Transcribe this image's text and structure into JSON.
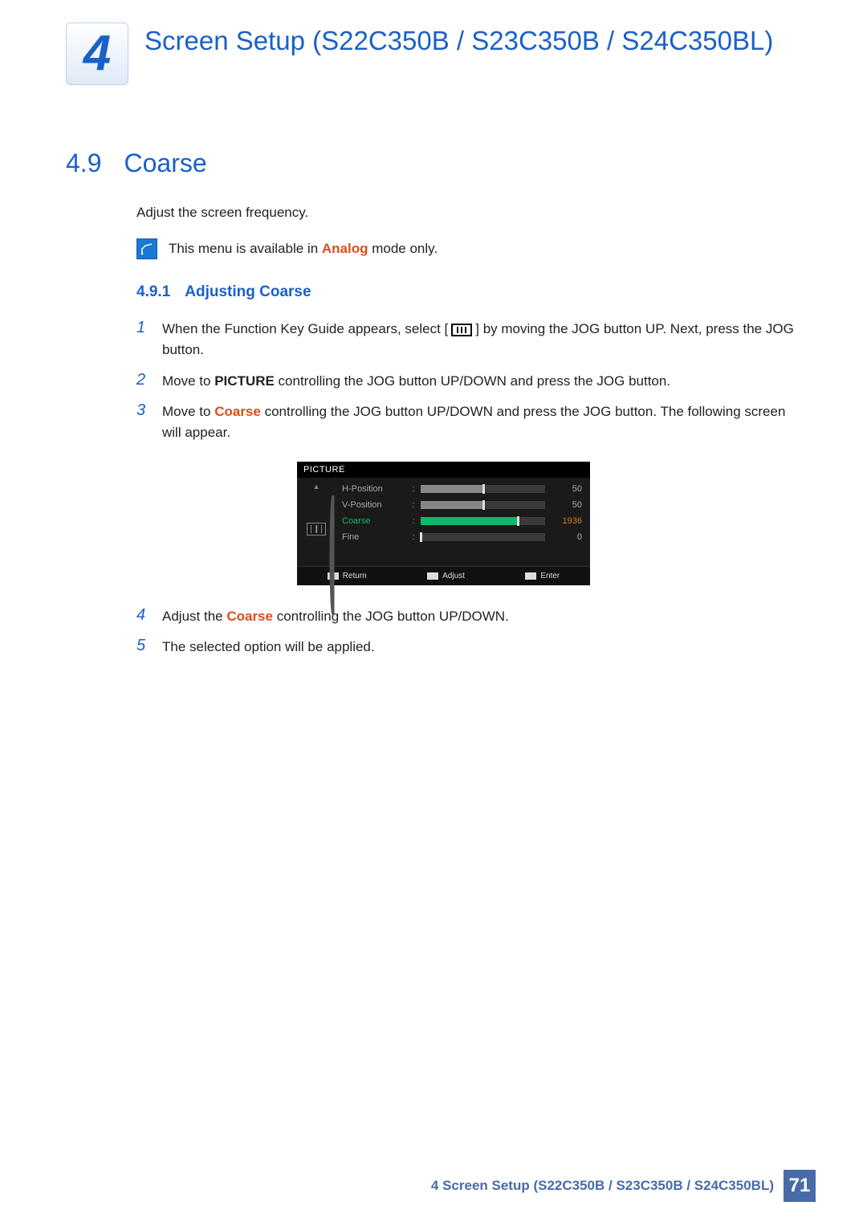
{
  "chapter": {
    "number": "4",
    "title": "Screen Setup (S22C350B / S23C350B / S24C350BL)"
  },
  "section": {
    "number": "4.9",
    "title": "Coarse",
    "intro": "Adjust the screen frequency.",
    "note_prefix": "This menu is available in ",
    "note_hl": "Analog",
    "note_suffix": " mode only."
  },
  "subsection": {
    "number": "4.9.1",
    "title": "Adjusting Coarse"
  },
  "steps": {
    "s1_num": "1",
    "s1a": "When the Function Key Guide appears, select [",
    "s1b": "] by moving the JOG button UP. Next, press the JOG button.",
    "s2_num": "2",
    "s2a": "Move to ",
    "s2b": "PICTURE",
    "s2c": " controlling the JOG button UP/DOWN and press the JOG button.",
    "s3_num": "3",
    "s3a": "Move to ",
    "s3b": "Coarse",
    "s3c": " controlling the JOG button UP/DOWN and press the JOG button. The following screen will appear.",
    "s4_num": "4",
    "s4a": "Adjust the ",
    "s4b": "Coarse",
    "s4c": " controlling the JOG button UP/DOWN.",
    "s5_num": "5",
    "s5": "The selected option will be applied."
  },
  "osd": {
    "title": "PICTURE",
    "up": "▲",
    "rows": [
      {
        "label": "H-Position",
        "value": "50",
        "fill": 50,
        "selected": false
      },
      {
        "label": "V-Position",
        "value": "50",
        "fill": 50,
        "selected": false
      },
      {
        "label": "Coarse",
        "value": "1936",
        "fill": 78,
        "selected": true
      },
      {
        "label": "Fine",
        "value": "0",
        "fill": 0,
        "selected": false
      }
    ],
    "footer": {
      "return": "Return",
      "adjust": "Adjust",
      "enter": "Enter"
    }
  },
  "footer": {
    "text": "4 Screen Setup (S22C350B / S23C350B / S24C350BL)",
    "page": "71"
  }
}
